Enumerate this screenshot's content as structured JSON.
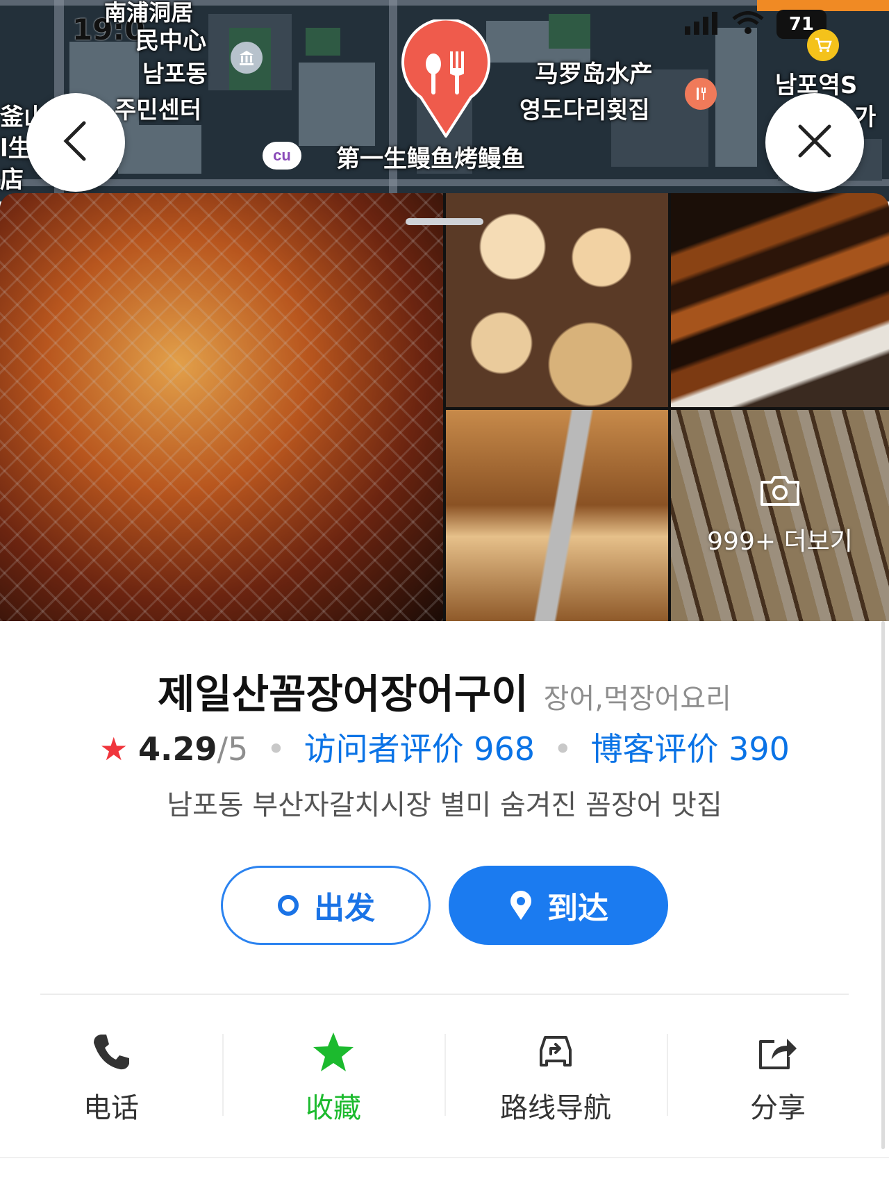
{
  "status_bar": {
    "time": "19:0",
    "battery": "71"
  },
  "map": {
    "labels": {
      "community_center_cn_1": "南浦洞居",
      "community_center_cn_2": "民中心",
      "community_center_kr_1": "남포동",
      "community_center_kr_2": "주민센터",
      "seafood_cn": "马罗岛水产",
      "seafood_kr": "영도다리횟집",
      "station": "남포역S",
      "target_restaurant": "第一生鳗鱼烤鳗鱼",
      "left_edge_1": "釜山",
      "left_edge_2": "l生",
      "left_edge_3": "店",
      "right_edge": "가",
      "cu_store": "cu"
    }
  },
  "photos": {
    "more_label": "999+ 더보기"
  },
  "place": {
    "name": "제일산꼼장어장어구이",
    "category": "장어,먹장어요리",
    "rating": "4.29",
    "rating_max": "/5",
    "visitor_reviews": "访问者评价 968",
    "blog_reviews": "博客评价 390",
    "description": "남포동 부산자갈치시장 별미 숨겨진 꼼장어 맛집"
  },
  "buttons": {
    "depart": "出发",
    "arrive": "到达"
  },
  "actions": [
    {
      "label": "电话",
      "icon": "phone-icon"
    },
    {
      "label": "收藏",
      "icon": "star-icon"
    },
    {
      "label": "路线导航",
      "icon": "car-route-icon"
    },
    {
      "label": "分享",
      "icon": "share-icon"
    }
  ],
  "colors": {
    "accent_blue": "#1b7bf0",
    "rating_star": "#f0353c",
    "favorite_green": "#1cba2e",
    "pin_red": "#ef5b4c"
  }
}
